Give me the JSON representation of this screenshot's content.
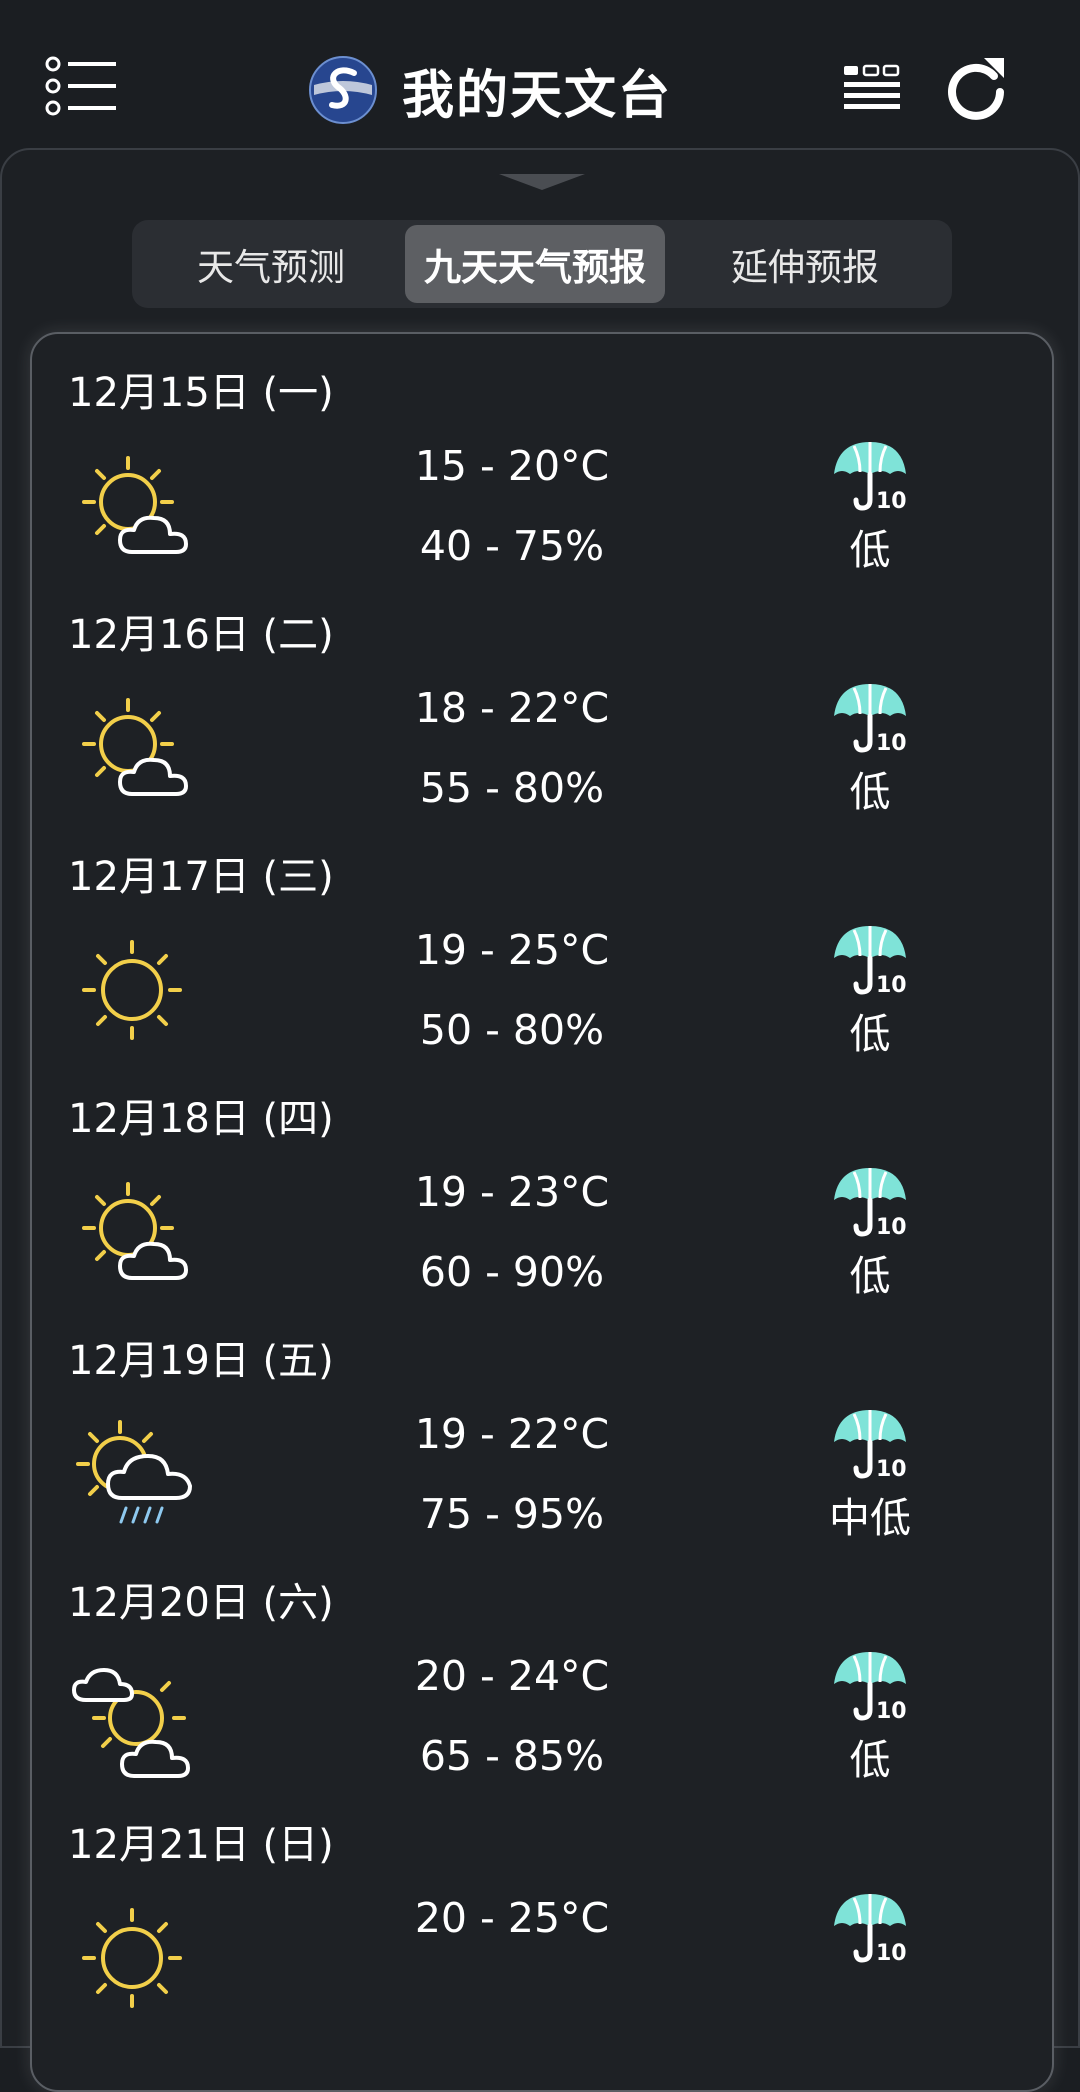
{
  "header": {
    "title": "我的天文台"
  },
  "tabs": [
    {
      "label": "天气预测"
    },
    {
      "label": "九天天气预报"
    },
    {
      "label": "延伸预报"
    }
  ],
  "forecast": [
    {
      "date": "12月15日 (一)",
      "temp": "15 - 20°C",
      "humidity": "40 - 75%",
      "psr": "低",
      "icon": "sunny-periods"
    },
    {
      "date": "12月16日 (二)",
      "temp": "18 - 22°C",
      "humidity": "55 - 80%",
      "psr": "低",
      "icon": "sunny-periods"
    },
    {
      "date": "12月17日 (三)",
      "temp": "19 - 25°C",
      "humidity": "50 - 80%",
      "psr": "低",
      "icon": "sunny"
    },
    {
      "date": "12月18日 (四)",
      "temp": "19 - 23°C",
      "humidity": "60 - 90%",
      "psr": "低",
      "icon": "sunny-periods"
    },
    {
      "date": "12月19日 (五)",
      "temp": "19 - 22°C",
      "humidity": "75 - 95%",
      "psr": "中低",
      "icon": "sunny-periods-showers"
    },
    {
      "date": "12月20日 (六)",
      "temp": "20 - 24°C",
      "humidity": "65 - 85%",
      "psr": "低",
      "icon": "sunny-intervals"
    },
    {
      "date": "12月21日 (日)",
      "temp": "20 - 25°C",
      "humidity": "",
      "psr": "",
      "icon": "sunny"
    }
  ],
  "psr_icon_label": "10",
  "colors": {
    "background": "#1b1e22",
    "sun": "#f2cf4a",
    "umbrella": "#7fe3d8",
    "rain": "#8ec9ef"
  }
}
